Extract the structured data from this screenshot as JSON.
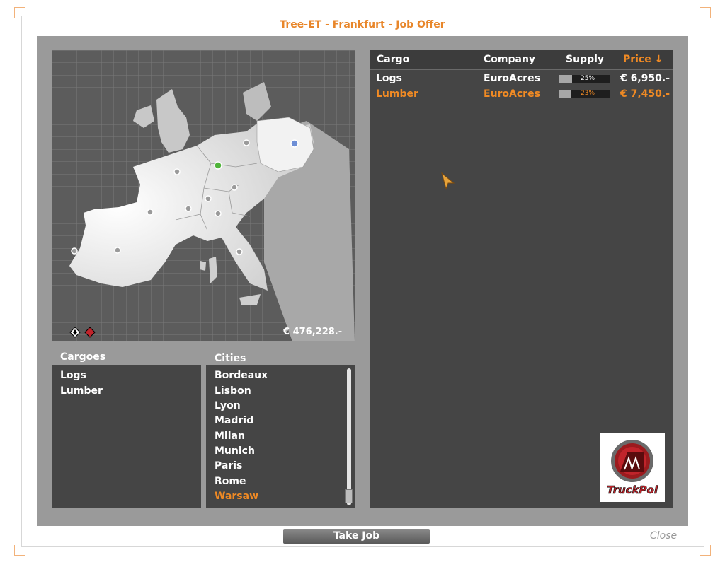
{
  "window": {
    "title": "Tree-ET - Frankfurt - Job Offer"
  },
  "map": {
    "balance": "€ 476,228.-"
  },
  "cargoes": {
    "label": "Cargoes",
    "items": [
      "Logs",
      "Lumber"
    ]
  },
  "cities": {
    "label": "Cities",
    "items": [
      "Bordeaux",
      "Lisbon",
      "Lyon",
      "Madrid",
      "Milan",
      "Munich",
      "Paris",
      "Rome",
      "Warsaw"
    ],
    "selected": "Warsaw"
  },
  "offers": {
    "headers": {
      "cargo": "Cargo",
      "company": "Company",
      "supply": "Supply",
      "price": "Price ↓"
    },
    "rows": [
      {
        "cargo": "Logs",
        "company": "EuroAcres",
        "supply_pct": 25,
        "supply": "25%",
        "price": "€ 6,950.-",
        "selected": false
      },
      {
        "cargo": "Lumber",
        "company": "EuroAcres",
        "supply_pct": 23,
        "supply": "23%",
        "price": "€ 7,450.-",
        "selected": true
      }
    ]
  },
  "logo": {
    "text": "TruckPol"
  },
  "buttons": {
    "take_job": "Take Job",
    "close": "Close"
  },
  "colors": {
    "accent": "#f08a24",
    "panel": "#454545",
    "background": "#9a9a9a"
  }
}
